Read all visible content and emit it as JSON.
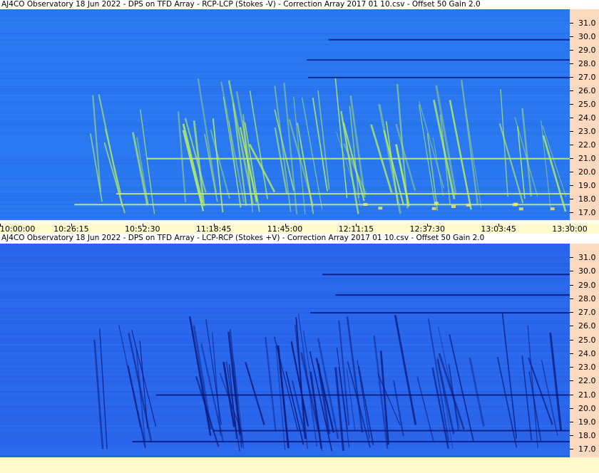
{
  "chart_data": [
    {
      "type": "heatmap",
      "title": "AJ4CO Observatory 18 Jun 2022  -  DPS on TFD Array  -  RCP-LCP (Stokes -V)  -  Correction Array 2017 01 10.csv  -  Offset 50  Gain 2.0",
      "x_ticks": [
        "10:00:00",
        "10:26:15",
        "10:52:30",
        "11:18:45",
        "11:45:00",
        "12:11:15",
        "12:37:30",
        "13:03:45",
        "13:30:00"
      ],
      "y_ticks": [
        "17.0",
        "18.0",
        "19.0",
        "20.0",
        "21.0",
        "22.0",
        "23.0",
        "24.0",
        "25.0",
        "26.0",
        "27.0",
        "28.0",
        "29.0",
        "30.0",
        "31.0"
      ],
      "xlim": [
        "10:00:00",
        "13:30:00"
      ],
      "ylim": [
        16.4,
        32.0
      ],
      "colors": {
        "background": "#2a78f0",
        "bright": "#b8f060",
        "peak": "#ffe860",
        "dark": "#0a1a8a"
      }
    },
    {
      "type": "heatmap",
      "title": "AJ4CO Observatory 18 Jun 2022  -  DPS on TFD Array  -  LCP-RCP (Stokes +V)  -  Correction Array 2017 01 10.csv  -  Offset 50  Gain 2.0",
      "x_ticks": [],
      "y_ticks": [
        "17.0",
        "18.0",
        "19.0",
        "20.0",
        "21.0",
        "22.0",
        "23.0",
        "24.0",
        "25.0",
        "26.0",
        "27.0",
        "28.0",
        "29.0",
        "30.0",
        "31.0"
      ],
      "xlim": [
        "10:00:00",
        "13:30:00"
      ],
      "ylim": [
        16.4,
        32.0
      ],
      "colors": {
        "background": "#2a66ec",
        "bright": "#b8f060",
        "dark": "#08167a"
      }
    }
  ]
}
